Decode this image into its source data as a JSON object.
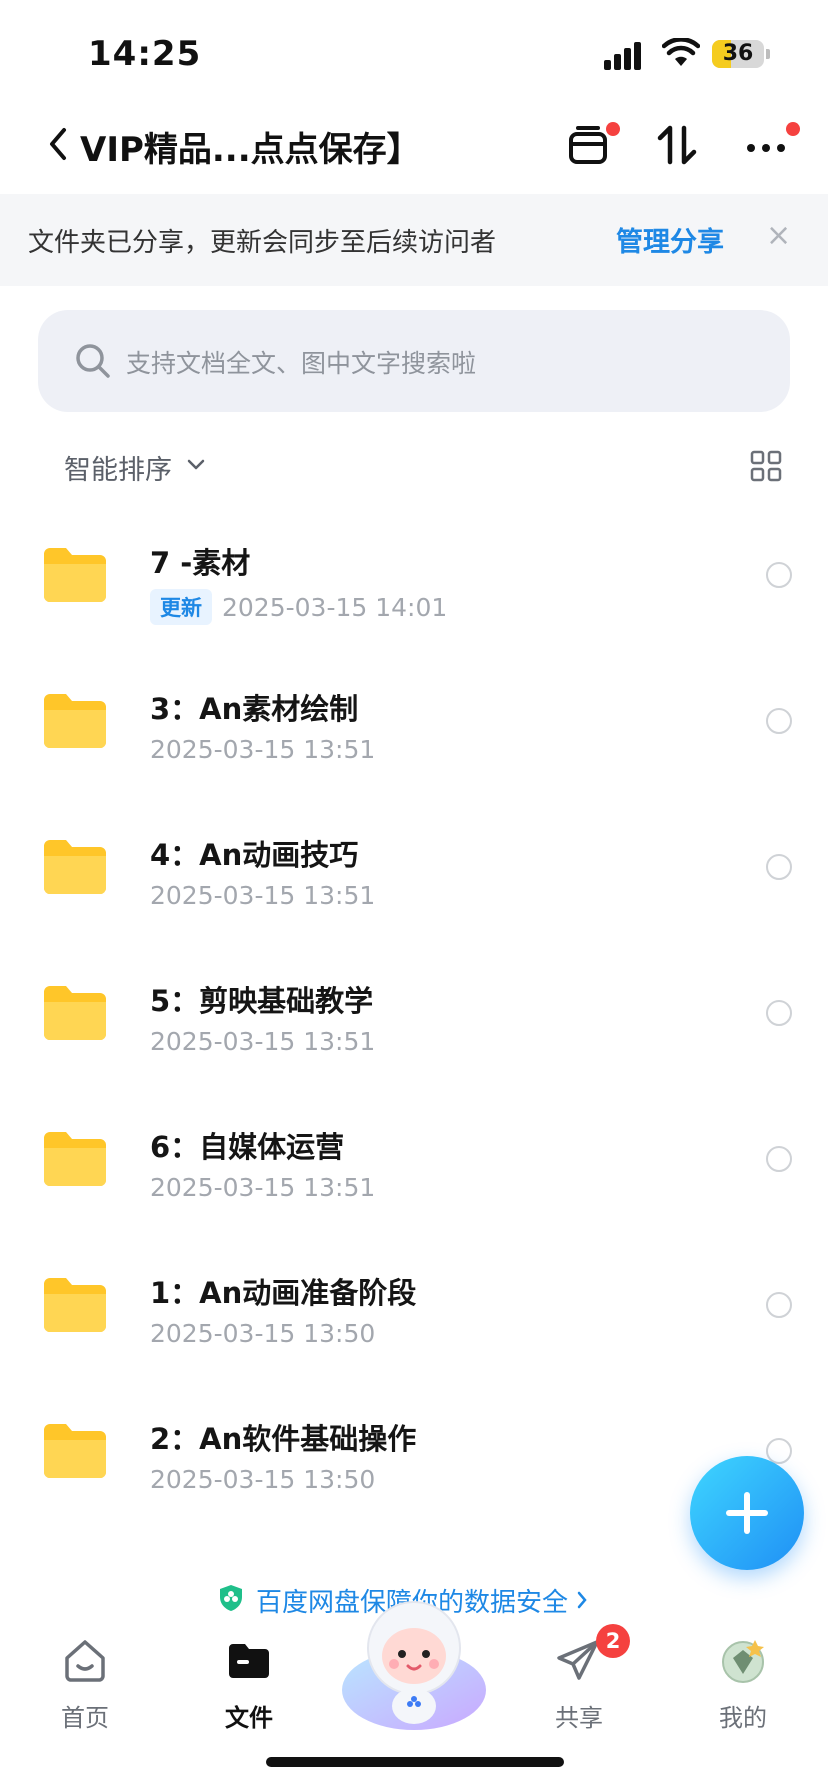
{
  "status_bar": {
    "time": "14:25",
    "battery_level": "36",
    "battery_fraction": 0.36
  },
  "nav": {
    "title": "VIP精品...点点保存】"
  },
  "share_banner": {
    "message": "文件夹已分享，更新会同步至后续访问者",
    "manage_label": "管理分享",
    "close_glyph": "×"
  },
  "search": {
    "placeholder": "支持文档全文、图中文字搜索啦"
  },
  "sort": {
    "label": "智能排序"
  },
  "files": [
    {
      "name": "7 -素材",
      "badge": "更新",
      "date": "2025-03-15 14:01"
    },
    {
      "name": "3：An素材绘制",
      "badge": "",
      "date": "2025-03-15 13:51"
    },
    {
      "name": "4：An动画技巧",
      "badge": "",
      "date": "2025-03-15 13:51"
    },
    {
      "name": "5：剪映基础教学",
      "badge": "",
      "date": "2025-03-15 13:51"
    },
    {
      "name": "6：自媒体运营",
      "badge": "",
      "date": "2025-03-15 13:51"
    },
    {
      "name": "1：An动画准备阶段",
      "badge": "",
      "date": "2025-03-15 13:50"
    },
    {
      "name": "2：An软件基础操作",
      "badge": "",
      "date": "2025-03-15 13:50"
    }
  ],
  "security_notice": {
    "text": "百度网盘保障你的数据安全"
  },
  "tabs": [
    {
      "label": "首页",
      "icon": "home-icon"
    },
    {
      "label": "文件",
      "icon": "folder-tab-icon",
      "active": true
    },
    {
      "label": "",
      "icon": "assistant-avatar-icon"
    },
    {
      "label": "共享",
      "icon": "send-icon",
      "badge": "2"
    },
    {
      "label": "我的",
      "icon": "vip-avatar-icon"
    }
  ],
  "colors": {
    "accent": "#1e88e5",
    "folder": "#ffc629",
    "badge_red": "#f5413f",
    "banner_bg": "#f5f6f8"
  }
}
